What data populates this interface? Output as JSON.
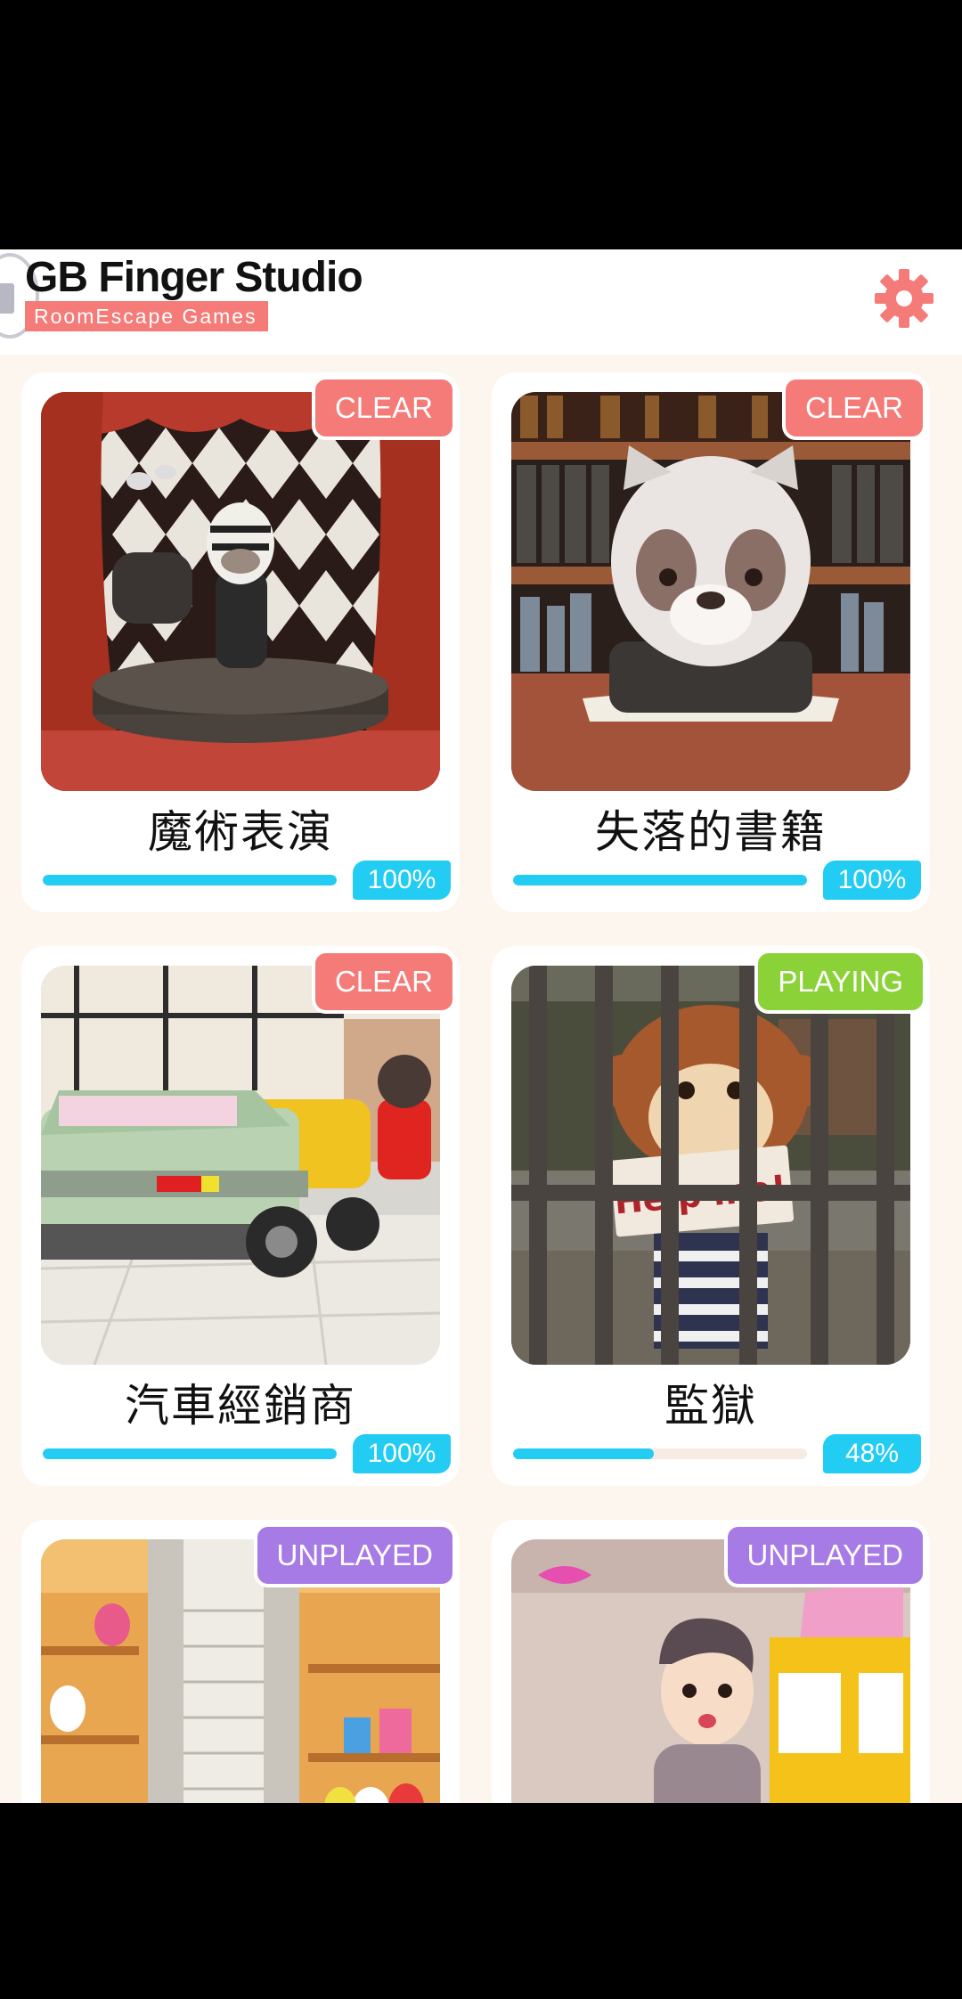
{
  "header": {
    "title": "GB Finger Studio",
    "subtitle": "RoomEscape  Games",
    "settings_icon": "gear-icon",
    "accent_color": "#f47b78"
  },
  "status_colors": {
    "clear": "#f47b78",
    "playing": "#8bd138",
    "unplayed": "#a77be6",
    "progress": "#22ccf2"
  },
  "games": [
    {
      "title": "魔術表演",
      "status": "CLEAR",
      "progress": 100,
      "progress_label": "100%",
      "scene": "magic-show"
    },
    {
      "title": "失落的書籍",
      "status": "CLEAR",
      "progress": 100,
      "progress_label": "100%",
      "scene": "library"
    },
    {
      "title": "汽車經銷商",
      "status": "CLEAR",
      "progress": 100,
      "progress_label": "100%",
      "scene": "car-dealer"
    },
    {
      "title": "監獄",
      "status": "PLAYING",
      "progress": 48,
      "progress_label": "48%",
      "scene": "prison",
      "sign_text": "Help me!"
    },
    {
      "title": "",
      "status": "UNPLAYED",
      "scene": "toy-store"
    },
    {
      "title": "",
      "status": "UNPLAYED",
      "scene": "arcade"
    }
  ]
}
